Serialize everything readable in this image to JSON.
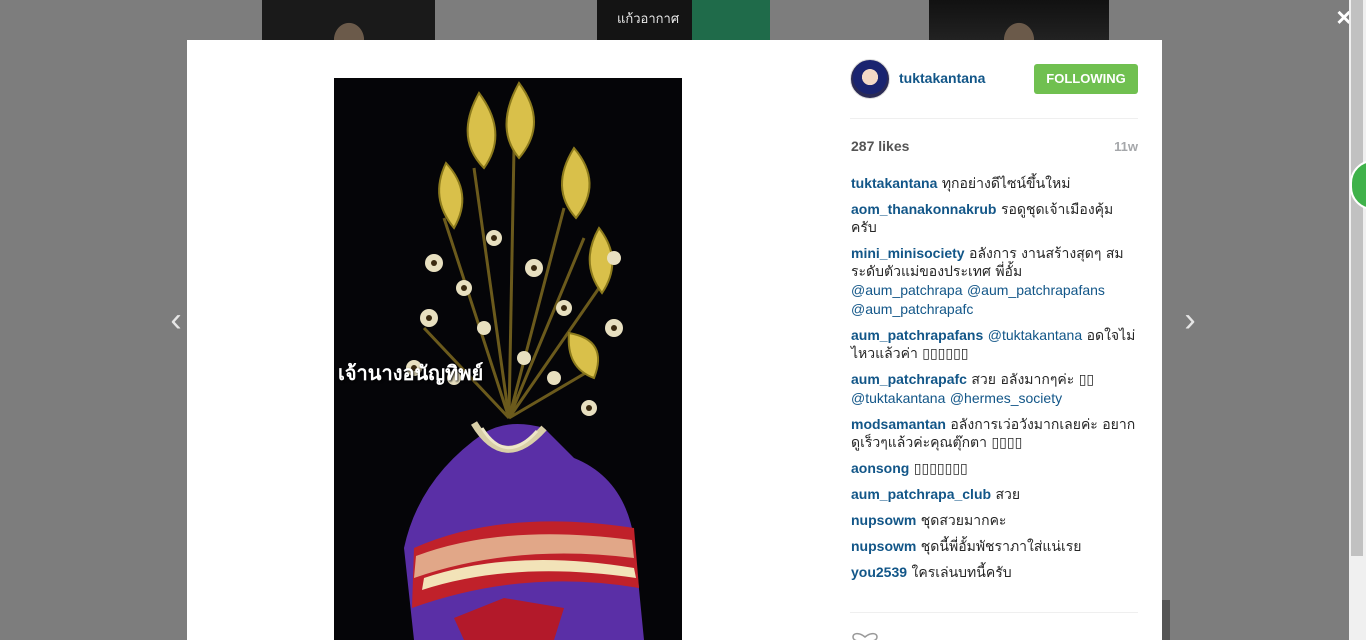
{
  "background_thumbs": [
    {
      "caption": ""
    },
    {
      "caption": "แก้วอากาศ"
    },
    {
      "caption": ""
    }
  ],
  "icons": {
    "close": "×",
    "prev": "‹",
    "next": "›"
  },
  "colors": {
    "accent_link": "#125688",
    "follow_button": "#70c050"
  },
  "photo": {
    "caption": "เจ้านางอนัญทิพย์"
  },
  "post": {
    "username": "tuktakantana",
    "follow_label": "FOLLOWING",
    "likes": "287 likes",
    "age": "11w"
  },
  "comments": [
    {
      "user": "tuktakantana",
      "text": "ทุกอย่างดีไซน์ขึ้นใหม่"
    },
    {
      "user": "aom_thanakonnakrub",
      "text": "รอดูชุดเจ้าเมืองคุ้มครับ"
    },
    {
      "user": "mini_minisociety",
      "text": "อลังการ งานสร้างสุดๆ สมระดับตัวแม่ของประเทศ พี่อั้ม",
      "mentions": [
        "@aum_patchrapa",
        "@aum_patchrapafans",
        "@aum_patchrapafc"
      ]
    },
    {
      "user": "aum_patchrapafans",
      "mentions": [
        "@tuktakantana"
      ],
      "text": "อดใจไม่ไหวแล้วค่า ▯▯▯▯▯▯"
    },
    {
      "user": "aum_patchrapafc",
      "text": "สวย อลังมากๆค่ะ ▯▯",
      "mentions": [
        "@tuktakantana",
        "@hermes_society"
      ]
    },
    {
      "user": "modsamantan",
      "text": "อลังการเว่อวังมากเลยค่ะ อยากดูเร็วๆแล้วค่ะคุณตุ๊กตา ▯▯▯▯"
    },
    {
      "user": "aonsong",
      "text": "▯▯▯▯▯▯▯"
    },
    {
      "user": "aum_patchrapa_club",
      "text": "สวย"
    },
    {
      "user": "nupsowm",
      "text": "ชุดสวยมากคะ"
    },
    {
      "user": "nupsowm",
      "text": "ชุดนี้พี่อั้มพัชราภาใส่แน่เรย"
    },
    {
      "user": "you2539",
      "text": "ใครเล่นบทนี้ครับ"
    }
  ]
}
